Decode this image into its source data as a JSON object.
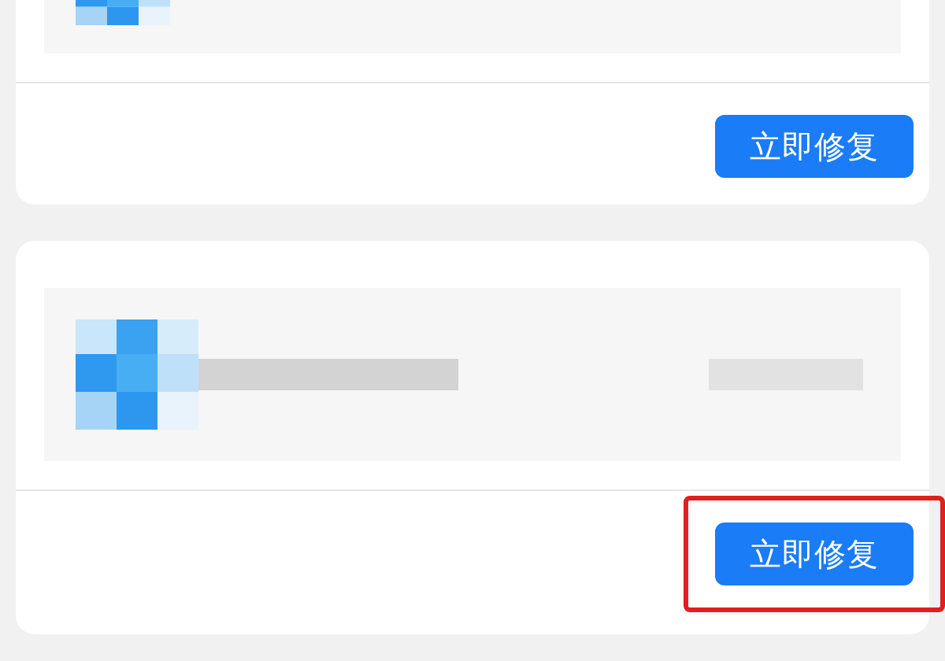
{
  "cards": [
    {
      "button": "立即修复",
      "highlighted": false,
      "cut_top": true
    },
    {
      "button": "立即修复",
      "highlighted": true,
      "cut_top": false
    }
  ]
}
